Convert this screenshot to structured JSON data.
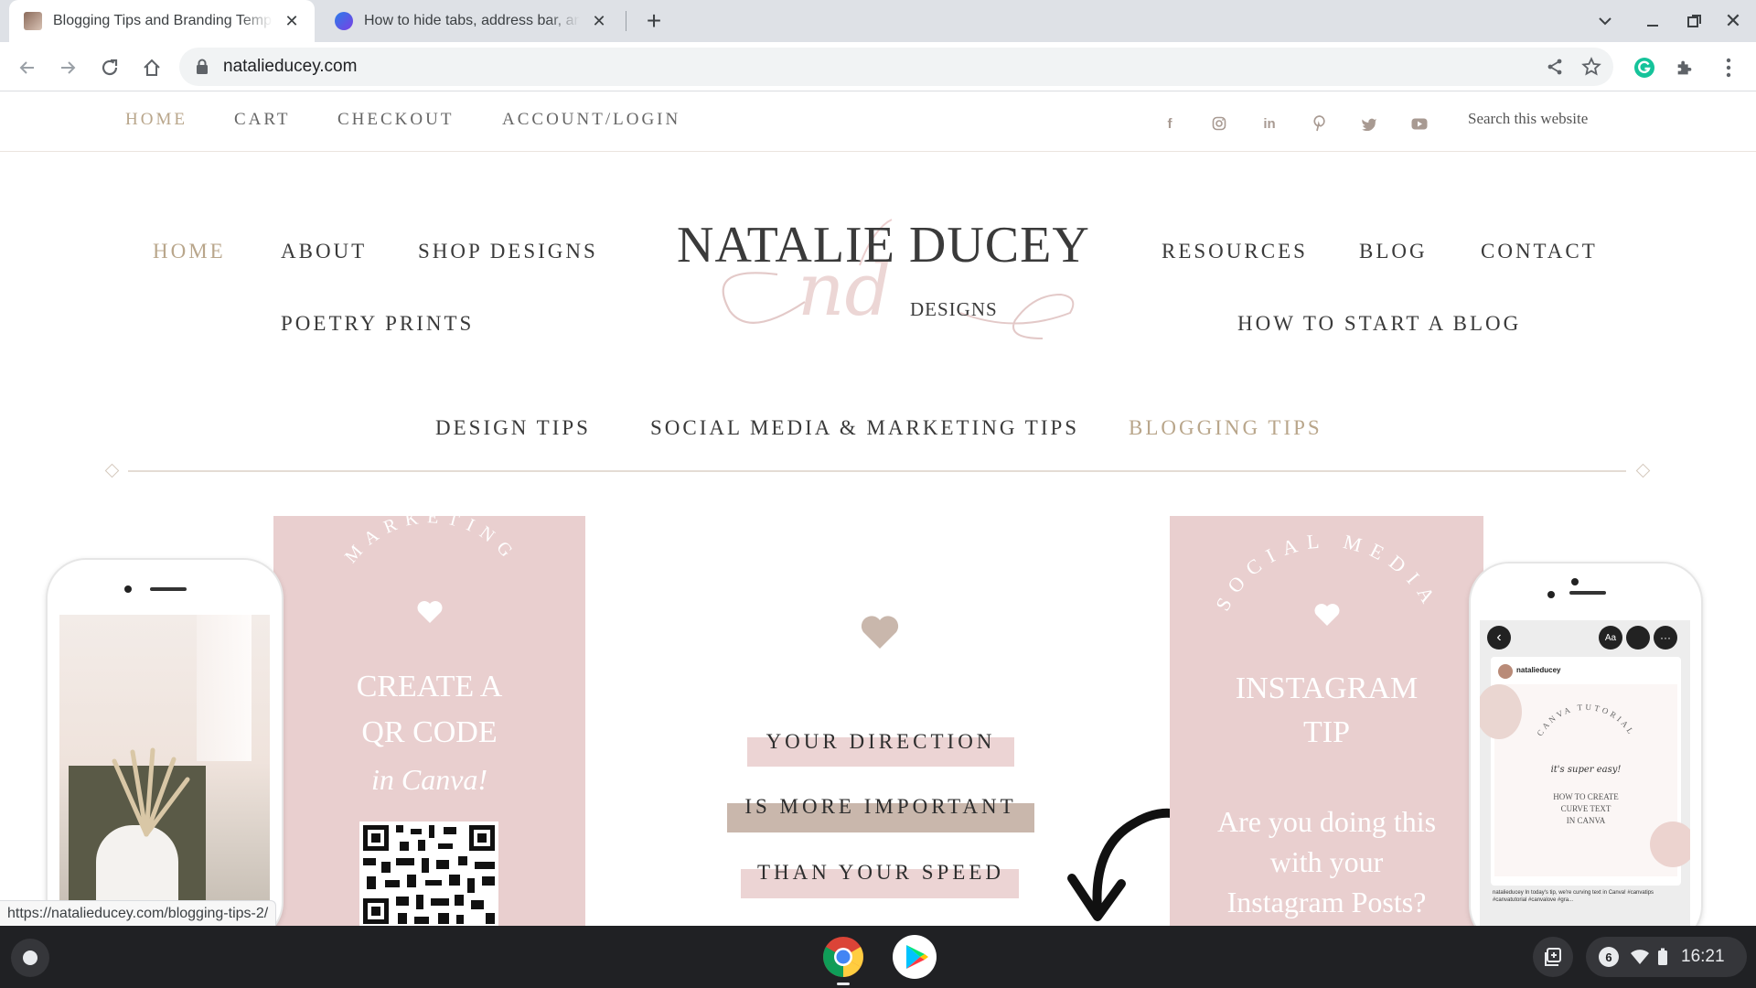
{
  "browser": {
    "tabs": [
      {
        "title": "Blogging Tips and Branding Templates",
        "active": true
      },
      {
        "title": "How to hide tabs, address bar, and toolbar",
        "active": false
      }
    ],
    "url": "natalieducey.com"
  },
  "site": {
    "top_nav": [
      "HOME",
      "CART",
      "CHECKOUT",
      "ACCOUNT/LOGIN"
    ],
    "social_icons": [
      "facebook-icon",
      "instagram-icon",
      "linkedin-icon",
      "pinterest-icon",
      "twitter-icon",
      "youtube-icon"
    ],
    "search_label": "Search this website",
    "main_nav_left": [
      "HOME",
      "ABOUT",
      "SHOP DESIGNS",
      "POETRY PRINTS"
    ],
    "main_nav_right": [
      "RESOURCES",
      "BLOG",
      "CONTACT",
      "HOW TO START A BLOG"
    ],
    "sub_nav": [
      "DESIGN TIPS",
      "SOCIAL MEDIA & MARKETING TIPS",
      "BLOGGING TIPS"
    ],
    "logo": {
      "name": "NATALIE DUCEY",
      "script": "nd",
      "sub": "DESIGNS"
    },
    "colors": {
      "gold": "#b9a68b",
      "blush": "#e9cfcf",
      "taupe": "#c9b7ac"
    }
  },
  "hero": {
    "card_left": {
      "arc": "MARKETING",
      "line1": "CREATE A",
      "line2": "QR CODE",
      "line3": "in Canva!"
    },
    "center_quote": [
      "YOUR DIRECTION",
      "IS MORE IMPORTANT",
      "THAN YOUR SPEED"
    ],
    "card_right": {
      "arc": "SOCIAL MEDIA",
      "line1": "INSTAGRAM",
      "line2": "TIP",
      "q1": "Are you doing this",
      "q2": "with your",
      "q3": "Instagram Posts?"
    },
    "phone_right": {
      "username": "natalieducey",
      "arc": "CANVA TUTORIAL",
      "script": "it's super easy!",
      "t1": "HOW TO CREATE",
      "t2": "CURVE TEXT",
      "t3": "IN CANVA",
      "caption": "natalieducey In today's tip, we're curving text in Canva! #canvatips #canvatutorial #canvalove #gra..."
    }
  },
  "status_url": "https://natalieducey.com/blogging-tips-2/",
  "shelf": {
    "notification_count": "6",
    "time": "16:21"
  }
}
